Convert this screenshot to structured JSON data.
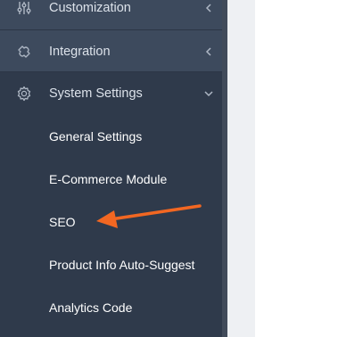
{
  "sidebar": {
    "items": [
      {
        "label": "Customization",
        "icon": "sliders-icon",
        "state": "collapsed"
      },
      {
        "label": "Integration",
        "icon": "puzzle-icon",
        "state": "collapsed"
      },
      {
        "label": "System Settings",
        "icon": "gear-icon",
        "state": "expanded",
        "children": [
          {
            "label": "General Settings"
          },
          {
            "label": "E-Commerce Module"
          },
          {
            "label": "SEO"
          },
          {
            "label": "Product Info Auto-Suggest"
          },
          {
            "label": "Analytics Code"
          }
        ]
      }
    ]
  },
  "annotation": {
    "type": "arrow",
    "color": "#f26722",
    "target": "SEO"
  },
  "colors": {
    "sidebar_bg": "#2f3a4b",
    "top_item_bg": "#3d4a5d",
    "text": "#dce2ea",
    "accent_arrow": "#f26722"
  }
}
